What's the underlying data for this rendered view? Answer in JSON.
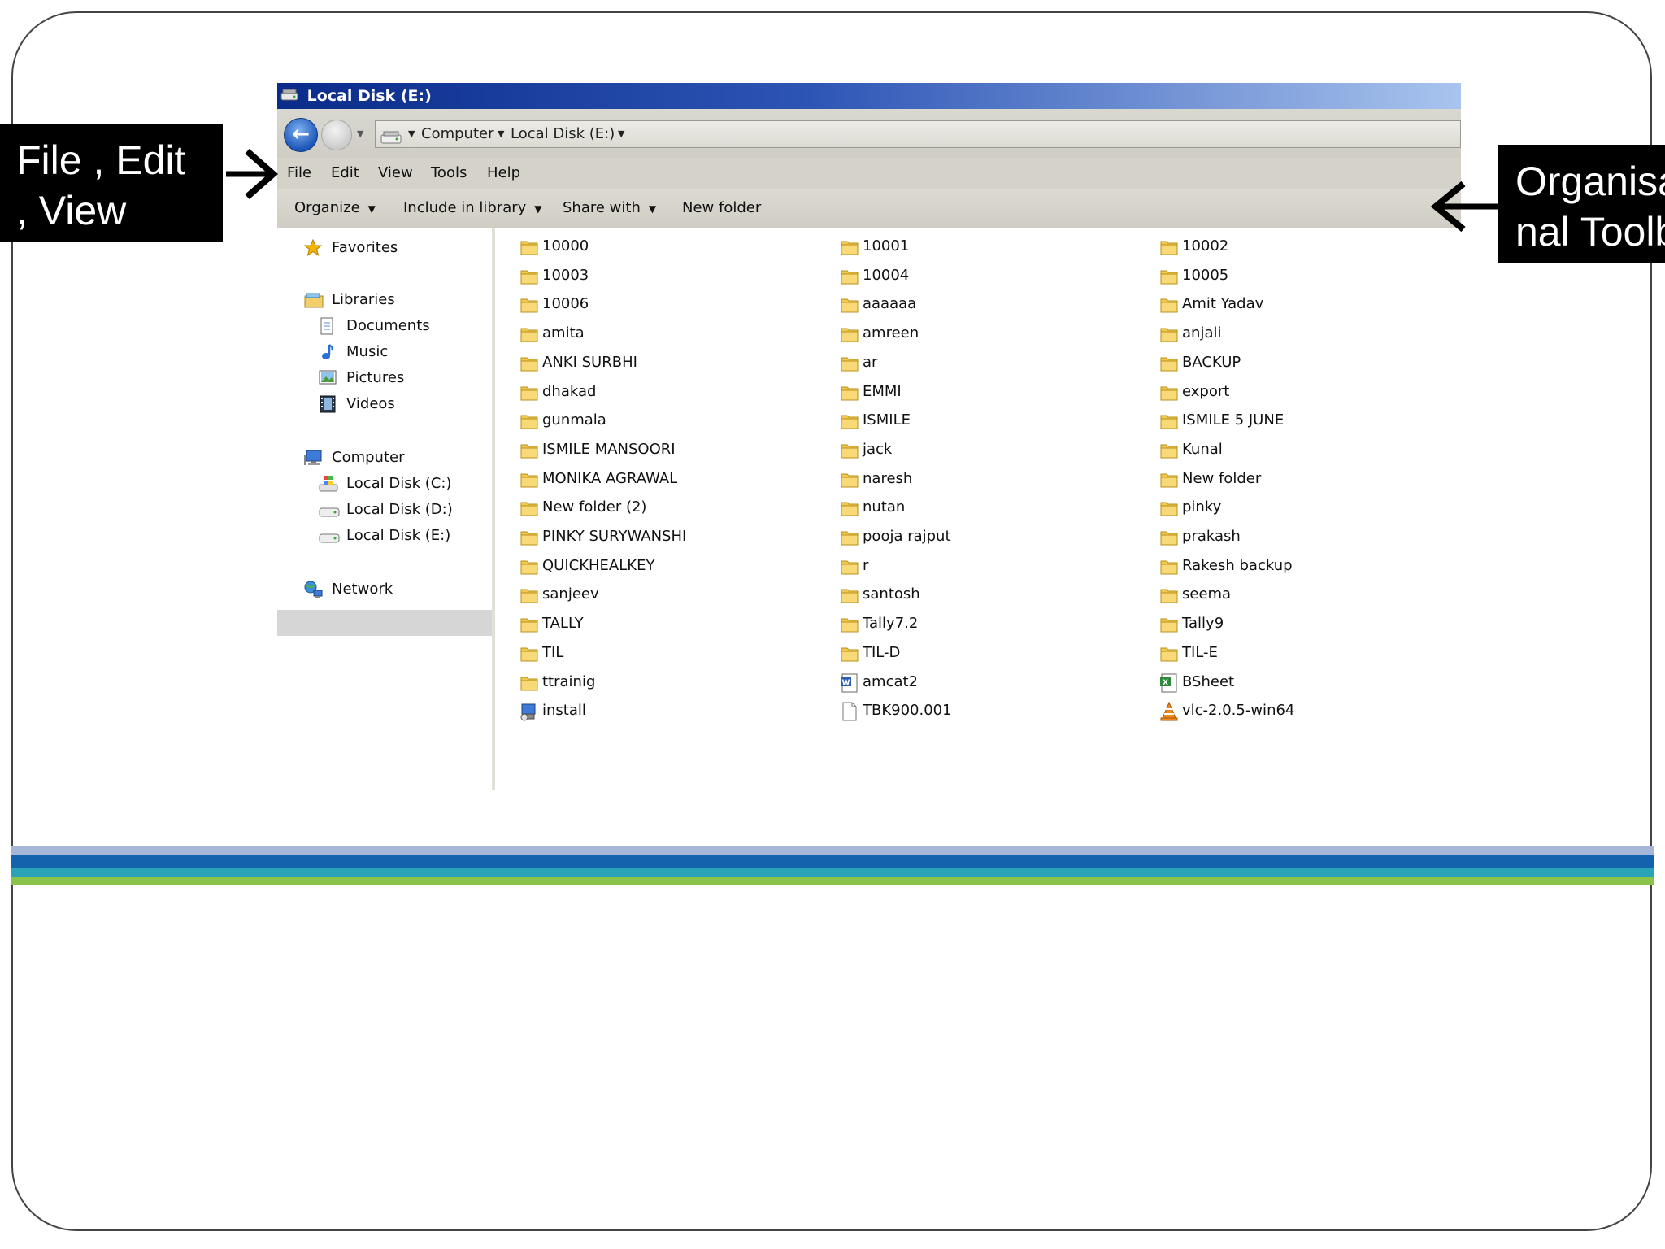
{
  "window": {
    "title": "Local Disk (E:)"
  },
  "address": {
    "crumbs": [
      "Computer",
      "Local Disk (E:)"
    ]
  },
  "menu": [
    "File",
    "Edit",
    "View",
    "Tools",
    "Help"
  ],
  "toolbar": {
    "organize": "Organize",
    "include": "Include in library",
    "share": "Share with",
    "new_folder": "New folder"
  },
  "nav": {
    "favorites": "Favorites",
    "libraries": "Libraries",
    "documents": "Documents",
    "music": "Music",
    "pictures": "Pictures",
    "videos": "Videos",
    "computer": "Computer",
    "disk_c": "Local Disk (C:)",
    "disk_d": "Local Disk (D:)",
    "disk_e": "Local Disk (E:)",
    "network": "Network"
  },
  "files": [
    [
      "10000",
      "10001",
      "10002"
    ],
    [
      "10003",
      "10004",
      "10005"
    ],
    [
      "10006",
      "aaaaaa",
      "Amit Yadav"
    ],
    [
      "amita",
      "amreen",
      "anjali"
    ],
    [
      "ANKI SURBHI",
      "ar",
      "BACKUP"
    ],
    [
      "dhakad",
      "EMMI",
      "export"
    ],
    [
      "gunmala",
      "ISMILE",
      "ISMILE 5 JUNE"
    ],
    [
      "ISMILE MANSOORI",
      "jack",
      "Kunal"
    ],
    [
      "MONIKA AGRAWAL",
      "naresh",
      "New folder"
    ],
    [
      "New folder (2)",
      "nutan",
      "pinky"
    ],
    [
      "PINKY SURYWANSHI",
      "pooja rajput",
      "prakash"
    ],
    [
      "QUICKHEALKEY",
      "r",
      "Rakesh backup"
    ],
    [
      "sanjeev",
      "santosh",
      "seema"
    ],
    [
      "TALLY",
      "Tally7.2",
      "Tally9"
    ],
    [
      "TIL",
      "TIL-D",
      "TIL-E"
    ],
    [
      "ttrainig",
      "amcat2",
      "BSheet"
    ],
    [
      "install",
      "TBK900.001",
      "vlc-2.0.5-win64"
    ]
  ],
  "file_icons": [
    [
      "folder",
      "folder",
      "folder"
    ],
    [
      "folder",
      "folder",
      "folder"
    ],
    [
      "folder",
      "folder",
      "folder"
    ],
    [
      "folder",
      "folder",
      "folder"
    ],
    [
      "folder",
      "folder",
      "folder"
    ],
    [
      "folder",
      "folder",
      "folder"
    ],
    [
      "folder",
      "folder",
      "folder"
    ],
    [
      "folder",
      "folder",
      "folder"
    ],
    [
      "folder",
      "folder",
      "folder"
    ],
    [
      "folder",
      "folder",
      "folder"
    ],
    [
      "folder",
      "folder",
      "folder"
    ],
    [
      "folder",
      "folder",
      "folder"
    ],
    [
      "folder",
      "folder",
      "folder"
    ],
    [
      "folder",
      "folder",
      "folder"
    ],
    [
      "folder",
      "folder",
      "folder"
    ],
    [
      "folder",
      "word-doc",
      "excel-sheet"
    ],
    [
      "installer",
      "blank-file",
      "vlc-cone"
    ]
  ],
  "annotations": {
    "left_line1": "File , Edit",
    "left_line2": ", View",
    "right_line1": "Organisa",
    "right_line2": "nal Toolb"
  },
  "colors": {
    "title_gradient_start": "#0a2b8a",
    "title_gradient_end": "#a9c4ee",
    "folder": "#f2c94c",
    "selected": "#d6d6d6"
  }
}
